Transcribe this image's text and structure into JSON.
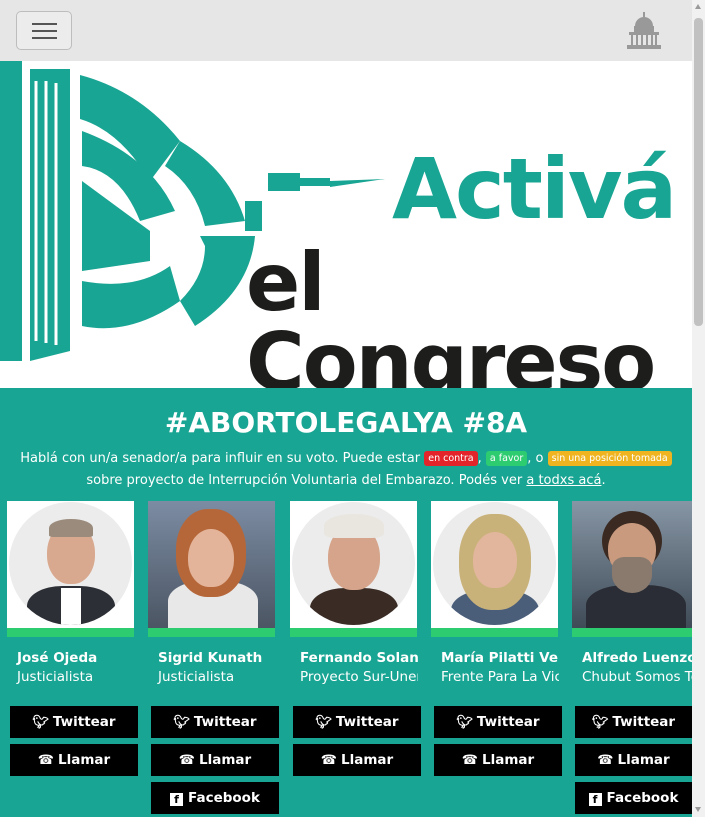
{
  "navbar": {
    "menu_icon": "hamburger-icon",
    "logo_icon": "congress-building-icon"
  },
  "hero": {
    "line1": "Activá",
    "line2": "el Congreso"
  },
  "campaign": {
    "hashtag": "#ABORTOLEGALYA #8A",
    "intro_before": "Hablá con un/a senador/a para influir en su voto. Puede estar ",
    "badge_contra": "en contra",
    "comma": ",",
    "badge_favor": "a favor",
    "o_text": ", o ",
    "badge_sin": "sin una posición tomada",
    "intro_after": " sobre proyecto de Interrupción Voluntaria del Embarazo. Podés ver ",
    "link_text": "a todxs acá",
    "period": "."
  },
  "colors": {
    "brand_teal": "#19a593",
    "green_bar": "#2ecc71",
    "contra": "#e3252b",
    "favor": "#2ecc71",
    "sin_posicion": "#f0b421"
  },
  "senators": [
    {
      "name": "José Ojeda",
      "party": "Justicialista",
      "tweet_label": "Twittear",
      "call_label": "Llamar",
      "facebook_label": ""
    },
    {
      "name": "Sigrid Kunath",
      "party": "Justicialista",
      "tweet_label": "Twittear",
      "call_label": "Llamar",
      "facebook_label": "Facebook"
    },
    {
      "name": "Fernando Solanas",
      "party": "Proyecto Sur-Unen",
      "tweet_label": "Twittear",
      "call_label": "Llamar",
      "facebook_label": ""
    },
    {
      "name": "María Pilatti Vergara",
      "party": "Frente Para La Victoria",
      "tweet_label": "Twittear",
      "call_label": "Llamar",
      "facebook_label": ""
    },
    {
      "name": "Alfredo Luenzo",
      "party": "Chubut Somos Todos",
      "tweet_label": "Twittear",
      "call_label": "Llamar",
      "facebook_label": "Facebook"
    }
  ]
}
